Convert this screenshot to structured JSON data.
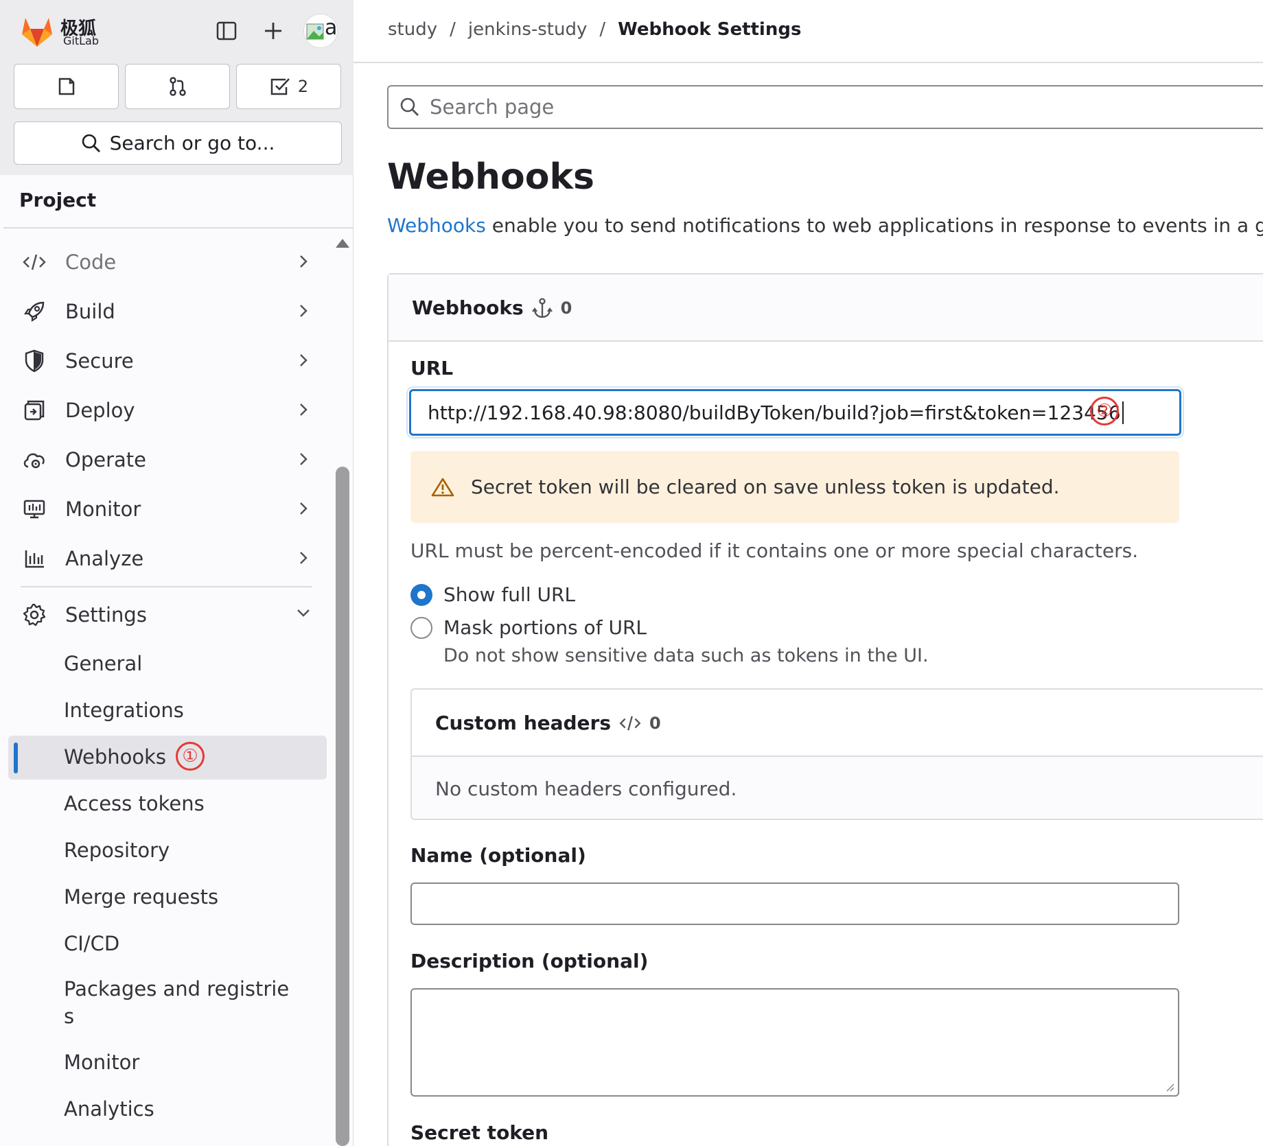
{
  "brand": {
    "name_cn": "极狐",
    "name_en": "GitLab"
  },
  "topbar": {
    "avatar_letter": "a",
    "todo_count": "2",
    "search_label": "Search or go to..."
  },
  "sidebar": {
    "section_label": "Project",
    "items": [
      {
        "label": "Code"
      },
      {
        "label": "Build"
      },
      {
        "label": "Secure"
      },
      {
        "label": "Deploy"
      },
      {
        "label": "Operate"
      },
      {
        "label": "Monitor"
      },
      {
        "label": "Analyze"
      },
      {
        "label": "Settings"
      }
    ],
    "settings_sub": [
      {
        "label": "General"
      },
      {
        "label": "Integrations"
      },
      {
        "label": "Webhooks"
      },
      {
        "label": "Access tokens"
      },
      {
        "label": "Repository"
      },
      {
        "label": "Merge requests"
      },
      {
        "label": "CI/CD"
      },
      {
        "label": "Packages and registrie",
        "label2": "s"
      },
      {
        "label": "Monitor"
      },
      {
        "label": "Analytics"
      }
    ],
    "active_item": "Webhooks"
  },
  "annotations": {
    "marker1": "①",
    "marker2": "②"
  },
  "breadcrumb": {
    "items": [
      "study",
      "jenkins-study"
    ],
    "current": "Webhook Settings",
    "separator": "/"
  },
  "page": {
    "search_placeholder": "Search page",
    "title": "Webhooks",
    "description_link": "Webhooks",
    "description_rest": " enable you to send notifications to web applications in response to events in a group"
  },
  "webhooks_card": {
    "title": "Webhooks",
    "count": "0",
    "url_label": "URL",
    "url_value": "http://192.168.40.98:8080/buildByToken/build?job=first&token=123456",
    "alert_text": "Secret token will be cleared on save unless token is updated.",
    "url_help": "URL must be percent-encoded if it contains one or more special characters.",
    "radio_show_full": "Show full URL",
    "radio_mask": "Mask portions of URL",
    "radio_mask_help": "Do not show sensitive data such as tokens in the UI.",
    "selected_radio": "Show full URL",
    "custom_headers_title": "Custom headers",
    "custom_headers_count": "0",
    "custom_headers_empty": "No custom headers configured.",
    "name_label": "Name (optional)",
    "name_value": "",
    "description_label": "Description (optional)",
    "description_value": "",
    "secret_token_label": "Secret token"
  },
  "colors": {
    "accent": "#1f75cb",
    "alert_bg": "#fdf1dd",
    "alert_icon": "#ab6100",
    "marker": "#e53935"
  }
}
